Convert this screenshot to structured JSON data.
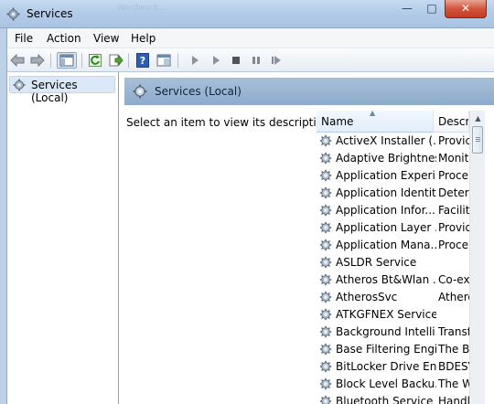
{
  "window": {
    "title": "Services",
    "ghost_tab": "Wordwork..."
  },
  "title_buttons": {
    "minimize": "—",
    "maximize": "□",
    "close": "✕"
  },
  "menu": [
    "File",
    "Action",
    "View",
    "Help"
  ],
  "toolbar": {
    "icons": [
      "back-arrow-icon",
      "forward-arrow-icon",
      "show-hide-console-tree-icon",
      "refresh-icon",
      "export-list-icon",
      "help-icon",
      "properties-pane-icon",
      "start-service-icon",
      "start-service-2-icon",
      "stop-service-icon",
      "pause-service-icon",
      "restart-service-icon"
    ]
  },
  "tree": {
    "item": "Services (Local)"
  },
  "pane": {
    "title": "Services (Local)",
    "description": "Select an item to view its description."
  },
  "list": {
    "columns": {
      "name": "Name",
      "description": "Descri"
    },
    "rows": [
      {
        "name": "ActiveX Installer (...",
        "desc": "Provic"
      },
      {
        "name": "Adaptive Brightness",
        "desc": "Monit"
      },
      {
        "name": "Application Experi...",
        "desc": "Proce"
      },
      {
        "name": "Application Identity",
        "desc": "Detern"
      },
      {
        "name": "Application Infor...",
        "desc": "Facilit"
      },
      {
        "name": "Application Layer ...",
        "desc": "Provid"
      },
      {
        "name": "Application Mana...",
        "desc": "Proce"
      },
      {
        "name": "ASLDR Service",
        "desc": ""
      },
      {
        "name": "Atheros Bt&Wlan ...",
        "desc": "Co-ex"
      },
      {
        "name": "AtherosSvc",
        "desc": "Athero"
      },
      {
        "name": "ATKGFNEX Service",
        "desc": ""
      },
      {
        "name": "Background Intelli...",
        "desc": "Transf"
      },
      {
        "name": "Base Filtering Engi...",
        "desc": "The B"
      },
      {
        "name": "BitLocker Drive En...",
        "desc": "BDESV"
      },
      {
        "name": "Block Level Backu...",
        "desc": "The W"
      },
      {
        "name": "Bluetooth Service",
        "desc": "Handl"
      }
    ]
  },
  "colors": {
    "accent_band": "#8eabcb",
    "selection": "#dbe8f7",
    "close": "#c43b22"
  }
}
